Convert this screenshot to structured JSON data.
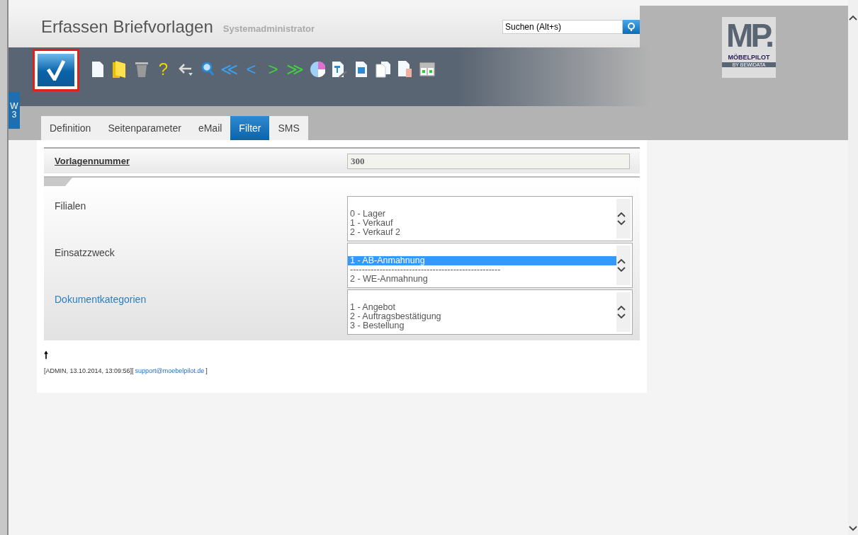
{
  "header": {
    "title": "Erfassen Briefvorlagen",
    "user": "Systemadministrator"
  },
  "search": {
    "placeholder": "Suchen (Alt+s)"
  },
  "logo": {
    "mark": "MP.",
    "name": "MÖBELPILOT",
    "tagline": "BY BEWIDATA"
  },
  "side_tab": {
    "label": "W",
    "count": "3"
  },
  "toolbar": [
    {
      "kind": "confirm",
      "highlighted": true
    },
    {
      "kind": "document"
    },
    {
      "kind": "folder"
    },
    {
      "kind": "trash"
    },
    {
      "kind": "glyph",
      "glyph": "?",
      "color": "#e8d800"
    },
    {
      "kind": "back"
    },
    {
      "kind": "magnifier"
    },
    {
      "kind": "glyph",
      "glyph": "≪",
      "color": "#3aa0f0"
    },
    {
      "kind": "glyph",
      "glyph": "<",
      "color": "#3aa0f0"
    },
    {
      "kind": "glyph",
      "glyph": ">",
      "color": "#40d040"
    },
    {
      "kind": "glyph",
      "glyph": "≫",
      "color": "#40d040"
    },
    {
      "kind": "chart"
    },
    {
      "kind": "doc-pen"
    },
    {
      "kind": "doc-badge"
    },
    {
      "kind": "copy"
    },
    {
      "kind": "doc-hand"
    },
    {
      "kind": "columns"
    }
  ],
  "tabs": [
    {
      "label": "Definition",
      "selected": false
    },
    {
      "label": "Seitenparameter",
      "selected": false
    },
    {
      "label": "eMail",
      "selected": false
    },
    {
      "label": "Filter",
      "selected": true
    },
    {
      "label": "SMS",
      "selected": false
    }
  ],
  "number_field": {
    "label": "Vorlagennummer",
    "value": "300"
  },
  "lists": [
    {
      "label": "Filialen",
      "link": false,
      "items": [
        {
          "text": "0 - Lager",
          "selected": false
        },
        {
          "text": "1 - Verkauf",
          "selected": false
        },
        {
          "text": "2 - Verkauf 2",
          "selected": false
        }
      ]
    },
    {
      "label": "Einsatzzweck",
      "link": false,
      "items": [
        {
          "text": "1 - AB-Anmahnung",
          "selected": true
        },
        {
          "text": "---------------------------------------------------",
          "selected": false
        },
        {
          "text": "2 - WE-Anmahnung",
          "selected": false
        }
      ]
    },
    {
      "label": "Dokumentkategorien",
      "link": true,
      "items": [
        {
          "text": "1 - Angebot",
          "selected": false
        },
        {
          "text": "2 - Auftragsbestätigung",
          "selected": false
        },
        {
          "text": "3 - Bestellung",
          "selected": false
        }
      ]
    }
  ],
  "footer": {
    "arrow": "🠕",
    "info": "[ADMIN, 13.10.2014, 13:09:56][",
    "email": "support@moebelpilot.de",
    "end": "]"
  }
}
